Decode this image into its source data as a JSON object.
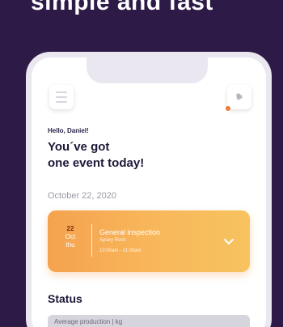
{
  "hero": {
    "headline": "simple and fast"
  },
  "app": {
    "greeting": "Hello, Daniel!",
    "headline_line1": "You´ve got",
    "headline_line2": "one event today!",
    "date": "October 22, 2020",
    "event": {
      "day": "22",
      "month": "Oct",
      "weekday": "thu",
      "title": "General inspection",
      "location": "Apiary Rock",
      "time": "10:00am - 11:00am"
    },
    "status": {
      "heading": "Status",
      "production_label": "Average production | kg"
    }
  },
  "colors": {
    "background": "#2e1a47",
    "accent_orange": "#f5a24e",
    "notification_dot": "#f07a3a"
  }
}
